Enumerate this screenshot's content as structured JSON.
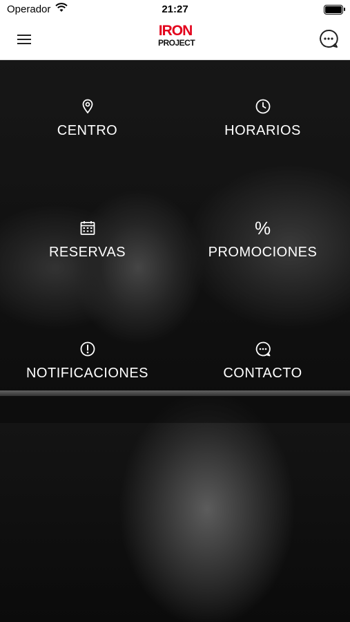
{
  "status_bar": {
    "carrier": "Operador",
    "time": "21:27"
  },
  "header": {
    "logo_top": "IRON",
    "logo_bottom": "PROJECT"
  },
  "menu": {
    "items": [
      {
        "label": "CENTRO",
        "icon": "location-pin-icon"
      },
      {
        "label": "HORARIOS",
        "icon": "clock-icon"
      },
      {
        "label": "RESERVAS",
        "icon": "calendar-icon"
      },
      {
        "label": "PROMOCIONES",
        "icon": "percent-icon",
        "glyph": "%"
      },
      {
        "label": "NOTIFICACIONES",
        "icon": "alert-circle-icon"
      },
      {
        "label": "CONTACTO",
        "icon": "chat-bubble-icon"
      }
    ]
  },
  "colors": {
    "brand_red": "#e3001b",
    "text_light": "#ffffff"
  }
}
